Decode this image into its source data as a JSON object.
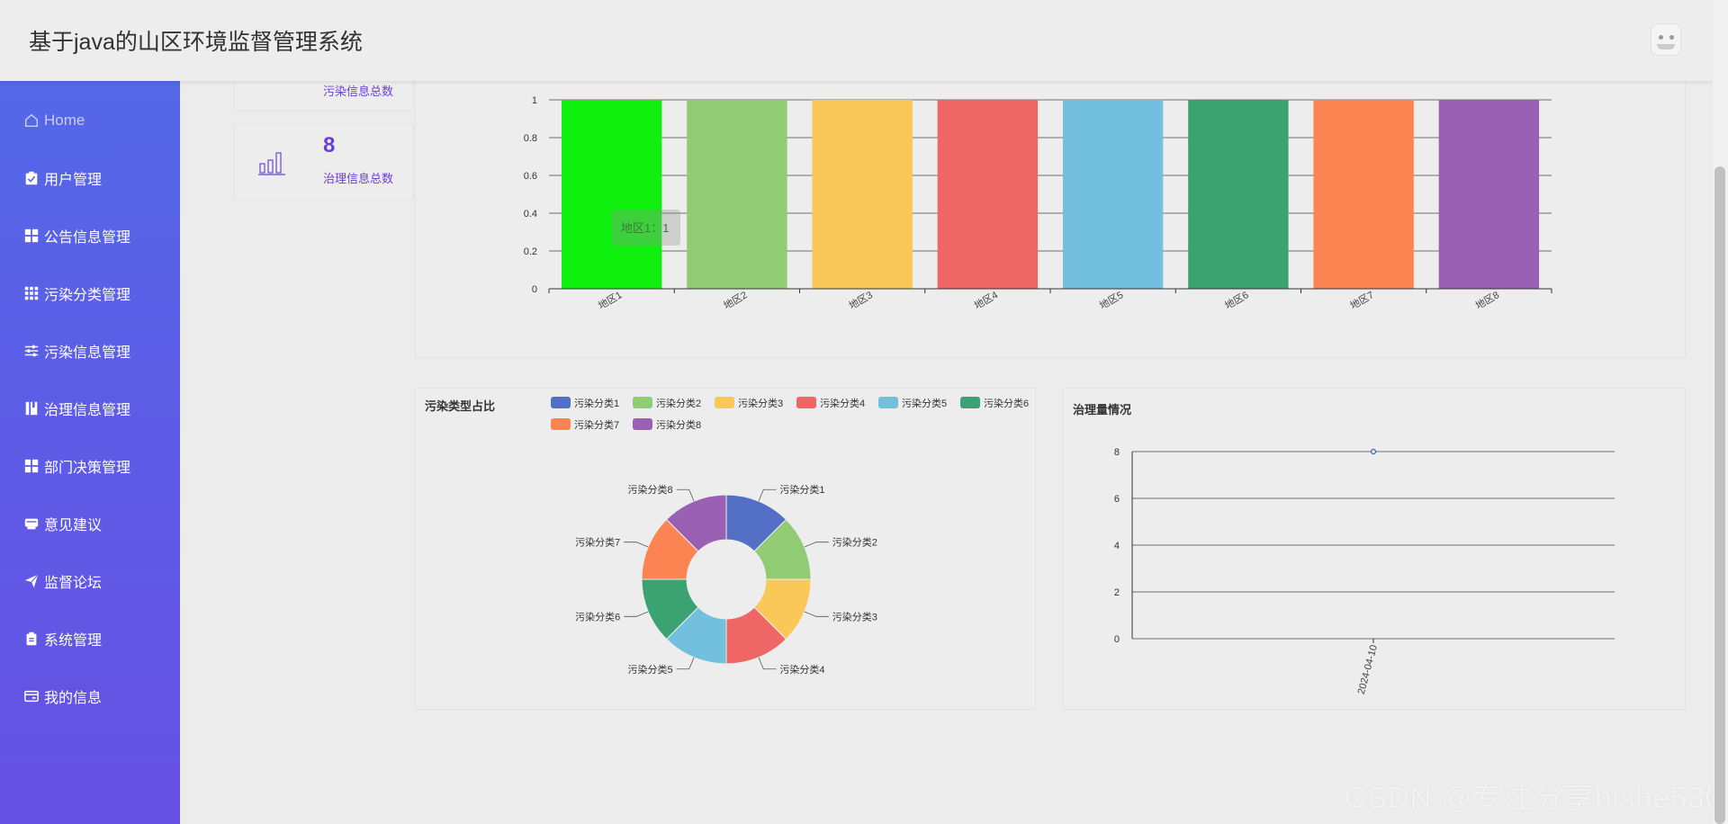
{
  "header": {
    "title": "基于java的山区环境监督管理系统"
  },
  "sidebar": {
    "items": [
      {
        "label": "Home",
        "icon": "home-icon"
      },
      {
        "label": "用户管理",
        "icon": "clipboard-check-icon"
      },
      {
        "label": "公告信息管理",
        "icon": "grid-icon"
      },
      {
        "label": "污染分类管理",
        "icon": "apps-icon"
      },
      {
        "label": "污染信息管理",
        "icon": "sliders-icon"
      },
      {
        "label": "治理信息管理",
        "icon": "book-icon"
      },
      {
        "label": "部门决策管理",
        "icon": "grid-icon"
      },
      {
        "label": "意见建议",
        "icon": "inbox-icon"
      },
      {
        "label": "监督论坛",
        "icon": "send-icon"
      },
      {
        "label": "系统管理",
        "icon": "clipboard-icon"
      },
      {
        "label": "我的信息",
        "icon": "card-icon"
      }
    ]
  },
  "stats": [
    {
      "label": "污染信息总数",
      "value": ""
    },
    {
      "label": "治理信息总数",
      "value": "8"
    }
  ],
  "colors": {
    "accent": "#6a3fd6",
    "palette": [
      "#5470c6",
      "#91cc75",
      "#fac858",
      "#ee6666",
      "#73c0de",
      "#3ba272",
      "#fc8452",
      "#9a60b4"
    ],
    "bar_first": "#0ff00f"
  },
  "tooltip": {
    "text": "地区1：1"
  },
  "watermark": "CSDN @专注分享bishe530",
  "chart_data": [
    {
      "type": "bar",
      "categories": [
        "地区1",
        "地区2",
        "地区3",
        "地区4",
        "地区5",
        "地区6",
        "地区7",
        "地区8"
      ],
      "values": [
        1,
        1,
        1,
        1,
        1,
        1,
        1,
        1
      ],
      "ylim": [
        0,
        1
      ],
      "yticks": [
        "0",
        "0.2",
        "0.4",
        "0.6",
        "0.8",
        "1"
      ],
      "grid": true
    },
    {
      "type": "pie",
      "title": "污染类型占比",
      "labels": [
        "污染分类1",
        "污染分类2",
        "污染分类3",
        "污染分类4",
        "污染分类5",
        "污染分类6",
        "污染分类7",
        "污染分类8"
      ],
      "values": [
        1,
        1,
        1,
        1,
        1,
        1,
        1,
        1
      ],
      "donut": true,
      "legend": "top-right"
    },
    {
      "type": "line",
      "title": "治理量情况",
      "x": [
        "2024-04-10"
      ],
      "values": [
        8
      ],
      "ylim": [
        0,
        8
      ],
      "yticks": [
        "0",
        "2",
        "4",
        "6",
        "8"
      ],
      "grid": true
    }
  ]
}
